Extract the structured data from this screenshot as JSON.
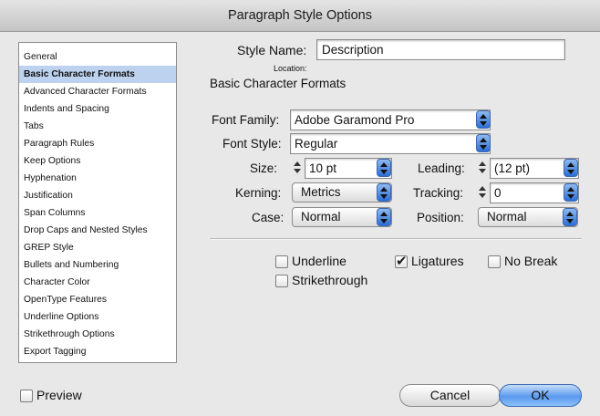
{
  "window": {
    "title": "Paragraph Style Options"
  },
  "sidebar": {
    "items": [
      {
        "label": "General",
        "selected": false
      },
      {
        "label": "Basic Character Formats",
        "selected": true
      },
      {
        "label": "Advanced Character Formats",
        "selected": false
      },
      {
        "label": "Indents and Spacing",
        "selected": false
      },
      {
        "label": "Tabs",
        "selected": false
      },
      {
        "label": "Paragraph Rules",
        "selected": false
      },
      {
        "label": "Keep Options",
        "selected": false
      },
      {
        "label": "Hyphenation",
        "selected": false
      },
      {
        "label": "Justification",
        "selected": false
      },
      {
        "label": "Span Columns",
        "selected": false
      },
      {
        "label": "Drop Caps and Nested Styles",
        "selected": false
      },
      {
        "label": "GREP Style",
        "selected": false
      },
      {
        "label": "Bullets and Numbering",
        "selected": false
      },
      {
        "label": "Character Color",
        "selected": false
      },
      {
        "label": "OpenType Features",
        "selected": false
      },
      {
        "label": "Underline Options",
        "selected": false
      },
      {
        "label": "Strikethrough Options",
        "selected": false
      },
      {
        "label": "Export Tagging",
        "selected": false
      }
    ]
  },
  "form": {
    "style_name_label": "Style Name:",
    "style_name_value": "Description",
    "location_label": "Location:",
    "section_title": "Basic Character Formats",
    "font_family_label": "Font Family:",
    "font_family_value": "Adobe Garamond Pro",
    "font_style_label": "Font Style:",
    "font_style_value": "Regular",
    "size_label": "Size:",
    "size_value": "10 pt",
    "leading_label": "Leading:",
    "leading_value": "(12 pt)",
    "kerning_label": "Kerning:",
    "kerning_value": "Metrics",
    "tracking_label": "Tracking:",
    "tracking_value": "0",
    "case_label": "Case:",
    "case_value": "Normal",
    "position_label": "Position:",
    "position_value": "Normal",
    "underline_label": "Underline",
    "underline_checked": false,
    "ligatures_label": "Ligatures",
    "ligatures_checked": true,
    "nobreak_label": "No Break",
    "nobreak_checked": false,
    "strikethrough_label": "Strikethrough",
    "strikethrough_checked": false
  },
  "footer": {
    "preview_label": "Preview",
    "preview_checked": false,
    "cancel_label": "Cancel",
    "ok_label": "OK"
  },
  "colors": {
    "accent": "#5b9af0",
    "selection": "#bcd2ee"
  }
}
